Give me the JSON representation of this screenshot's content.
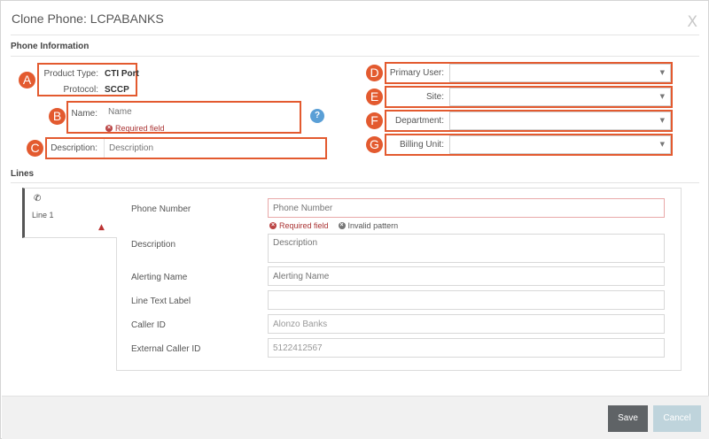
{
  "dialog": {
    "title": "Clone Phone: LCPABANKS",
    "close_label": "X"
  },
  "phone_info": {
    "section_title": "Phone Information",
    "product_type": {
      "label": "Product Type:",
      "value": "CTI Port"
    },
    "protocol": {
      "label": "Protocol:",
      "value": "SCCP"
    },
    "name": {
      "label": "Name:",
      "placeholder": "Name",
      "error": "Required field"
    },
    "description": {
      "label": "Description:",
      "placeholder": "Description"
    },
    "help_label": "?",
    "primary_user": {
      "label": "Primary User:",
      "value": ""
    },
    "site": {
      "label": "Site:",
      "value": ""
    },
    "department": {
      "label": "Department:",
      "value": ""
    },
    "billing_unit": {
      "label": "Billing Unit:",
      "value": ""
    }
  },
  "lines": {
    "section_title": "Lines",
    "tab_label": "Line 1",
    "tab_icon": "phone-icon",
    "tab_warning_icon": "warning-icon",
    "phone_number": {
      "label": "Phone Number",
      "placeholder": "Phone Number",
      "error_required": "Required field",
      "error_pattern": "Invalid pattern"
    },
    "description": {
      "label": "Description",
      "placeholder": "Description"
    },
    "alerting_name": {
      "label": "Alerting Name",
      "placeholder": "Alerting Name"
    },
    "line_text_label": {
      "label": "Line Text Label",
      "value": ""
    },
    "caller_id": {
      "label": "Caller ID",
      "value": "Alonzo Banks"
    },
    "external_caller_id": {
      "label": "External Caller ID",
      "value": "5122412567"
    }
  },
  "callouts": [
    "A",
    "B",
    "C",
    "D",
    "E",
    "F",
    "G"
  ],
  "footer": {
    "save_label": "Save",
    "cancel_label": "Cancel"
  },
  "colors": {
    "callout": "#e35a2f",
    "save_button": "#5f6366",
    "cancel_button": "#bfd4dc",
    "help": "#5a9fd6",
    "error": "#aa3333"
  }
}
